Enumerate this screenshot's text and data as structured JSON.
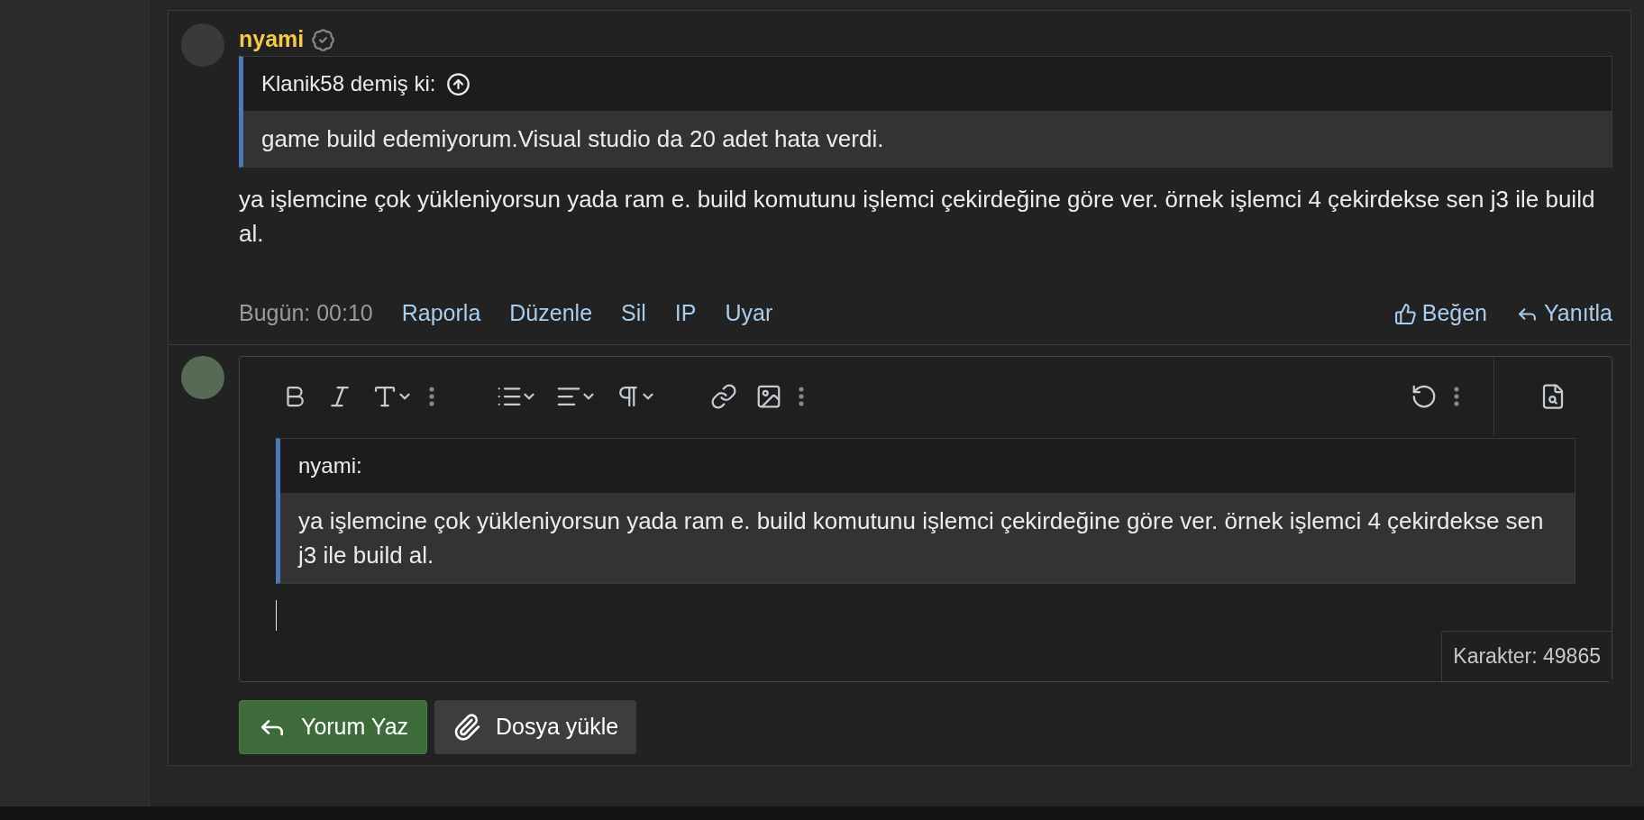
{
  "post": {
    "author": "nyami",
    "quote": {
      "author_line": "Klanik58 demiş ki:",
      "text": "game build edemiyorum.Visual studio da 20 adet hata verdi."
    },
    "body": "ya işlemcine çok yükleniyorsun yada ram e. build komutunu işlemci çekirdeğine göre ver. örnek işlemci 4 çekirdekse sen j3 ile build al.",
    "time": "Bugün: 00:10",
    "actions": [
      "Raporla",
      "Düzenle",
      "Sil",
      "IP",
      "Uyar"
    ],
    "reactions": [
      {
        "kind": "like",
        "label": "Beğen"
      },
      {
        "kind": "reply",
        "label": "Yanıtla"
      }
    ]
  },
  "editor": {
    "quote": {
      "author_line": "nyami:",
      "text": "ya işlemcine çok yükleniyorsun yada ram e. build komutunu işlemci çekirdeğine göre ver. örnek işlemci 4 çekirdekse sen j3 ile build al."
    },
    "char_count": "Karakter: 49865"
  },
  "buttons": [
    {
      "kind": "submit",
      "label": "Yorum Yaz"
    },
    {
      "kind": "attach",
      "label": "Dosya yükle"
    }
  ]
}
